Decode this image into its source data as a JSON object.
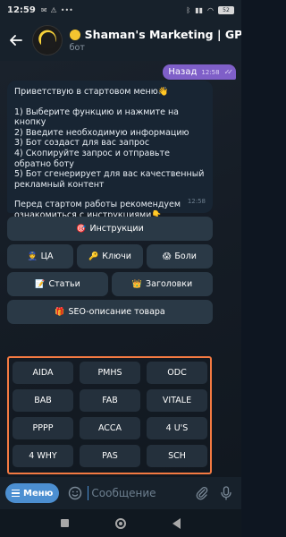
{
  "status_bar": {
    "time": "12:59",
    "left_icons": [
      "message-icon",
      "alert-icon",
      "dots-icon"
    ],
    "battery": "52"
  },
  "header": {
    "title": "Shaman's Marketing | GP",
    "subtitle": "бот"
  },
  "outgoing": {
    "text": "Назад",
    "time": "12:58"
  },
  "incoming": {
    "lines": [
      "Приветствую в стартовом меню👋",
      "",
      "1) Выберите функцию и нажмите на кнопку",
      "2) Введите необходимую информацию",
      "3) Бот создаст для вас запрос",
      "4) Скопируйте запрос и отправьте обратно боту",
      "5) Бот сгенерирует для вас качественный рекламный контент",
      "",
      "Перед стартом работы рекомендуем ознакомиться с инструкциями👇"
    ],
    "time": "12:58"
  },
  "inline_keyboard": {
    "instructions": {
      "emoji": "🎯",
      "label": "Инструкции"
    },
    "ca": {
      "emoji": "👮",
      "label": "ЦА"
    },
    "keys": {
      "emoji": "🔑",
      "label": "Ключи"
    },
    "pains": {
      "emoji": "😱",
      "label": "Боли"
    },
    "articles": {
      "emoji": "📝",
      "label": "Статьи"
    },
    "headlines": {
      "emoji": "👑",
      "label": "Заголовки"
    },
    "seo": {
      "emoji": "🎁",
      "label": "SEO-описание товара"
    }
  },
  "reply_keyboard": {
    "rows": [
      [
        "AIDA",
        "PMHS",
        "ODC"
      ],
      [
        "BAB",
        "FAB",
        "VITALE"
      ],
      [
        "PPPP",
        "ACCA",
        "4 U'S"
      ],
      [
        "4 WHY",
        "PAS",
        "SCH"
      ]
    ]
  },
  "input_bar": {
    "menu_label": "Меню",
    "placeholder": "Сообщение"
  },
  "colors": {
    "accent": "#4c8fd1",
    "outgoing_bubble": "#7f5fc8",
    "highlight_border": "#f47a42"
  }
}
